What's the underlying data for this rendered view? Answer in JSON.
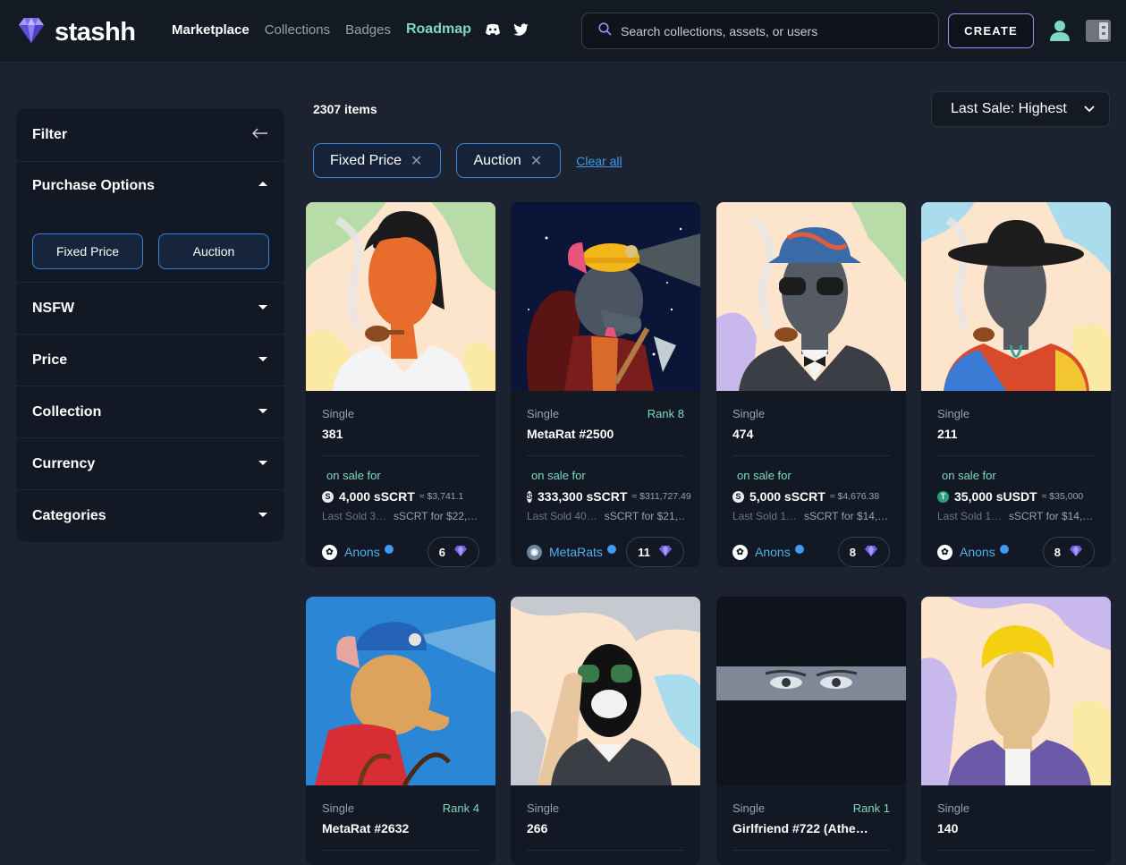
{
  "app": {
    "name": "stashh"
  },
  "nav": {
    "marketplace": "Marketplace",
    "collections": "Collections",
    "badges": "Badges",
    "roadmap": "Roadmap"
  },
  "search": {
    "placeholder": "Search collections, assets, or users"
  },
  "header": {
    "create_label": "CREATE"
  },
  "sidebar": {
    "filter_title": "Filter",
    "purchase_options": {
      "title": "Purchase Options",
      "options": [
        "Fixed Price",
        "Auction"
      ]
    },
    "sections": [
      "NSFW",
      "Price",
      "Collection",
      "Currency",
      "Categories"
    ]
  },
  "results": {
    "count_label": "2307 items",
    "sort_selected": "Last Sale: Highest"
  },
  "active_filters": [
    "Fixed Price",
    "Auction"
  ],
  "clear_all_label": "Clear all",
  "cards": [
    {
      "type": "Single",
      "rank": "",
      "name": "381",
      "sale_label": "on sale for",
      "price": "4,000 sSCRT",
      "usd": "≈ $3,741.1",
      "last_sold_label": "Last Sold 3…",
      "last_sold_value": "sSCRT for $22,…",
      "collection": "Anons",
      "badges": "6",
      "coin": "S"
    },
    {
      "type": "Single",
      "rank": "Rank 8",
      "name": "MetaRat #2500",
      "sale_label": "on sale for",
      "price": "333,300 sSCRT",
      "usd": "≈ $311,727.49",
      "last_sold_label": "Last Sold 40…",
      "last_sold_value": "sSCRT for $21,…",
      "collection": "MetaRats",
      "badges": "11",
      "coin": "S"
    },
    {
      "type": "Single",
      "rank": "",
      "name": "474",
      "sale_label": "on sale for",
      "price": "5,000 sSCRT",
      "usd": "≈ $4,676.38",
      "last_sold_label": "Last Sold 1…",
      "last_sold_value": "sSCRT for $14,…",
      "collection": "Anons",
      "badges": "8",
      "coin": "S"
    },
    {
      "type": "Single",
      "rank": "",
      "name": "211",
      "sale_label": "on sale for",
      "price": "35,000 sUSDT",
      "usd": "≈ $35,000",
      "last_sold_label": "Last Sold 1…",
      "last_sold_value": "sSCRT for $14,…",
      "collection": "Anons",
      "badges": "8",
      "coin": "T"
    },
    {
      "type": "Single",
      "rank": "Rank 4",
      "name": "MetaRat #2632"
    },
    {
      "type": "Single",
      "rank": "",
      "name": "266"
    },
    {
      "type": "Single",
      "rank": "Rank 1",
      "name": "Girlfriend #722 (Athe…"
    },
    {
      "type": "Single",
      "rank": "",
      "name": "140"
    }
  ],
  "colors": {
    "accent_teal": "#7ed9c3",
    "link_blue": "#3d9bf0",
    "create_border": "#9e8ff5",
    "background": "#1c2230"
  }
}
